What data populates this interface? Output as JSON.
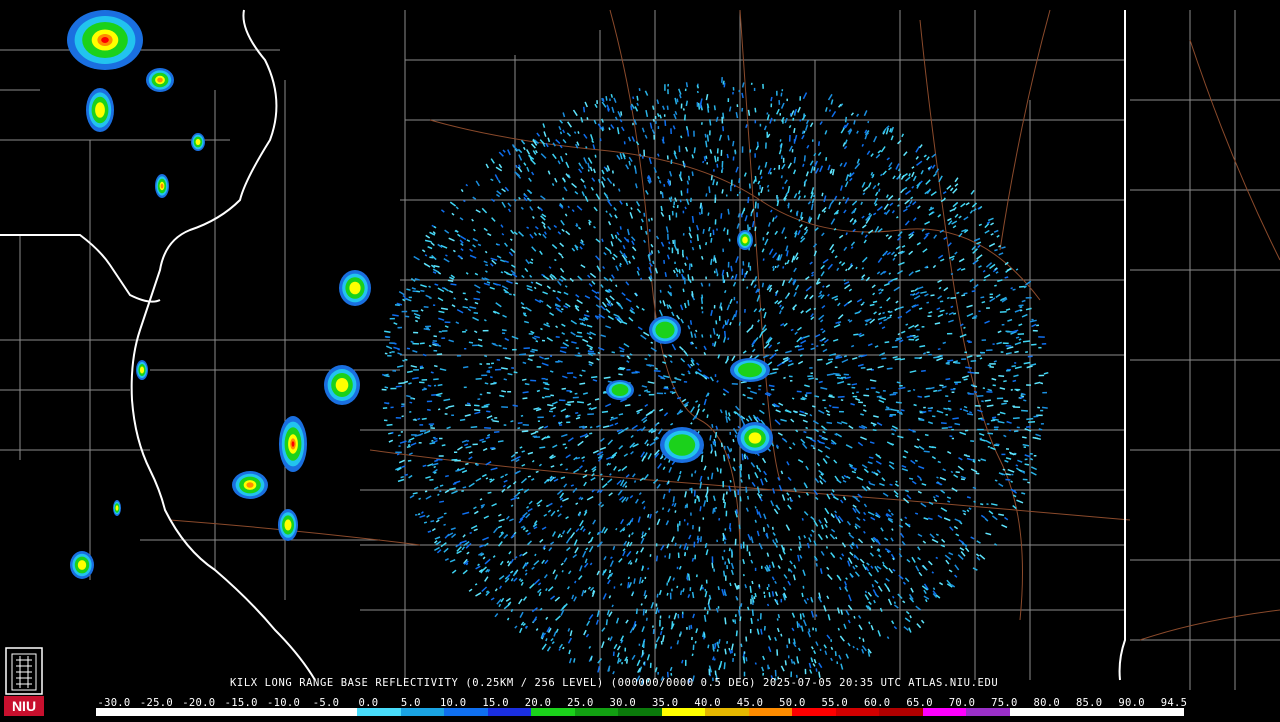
{
  "caption": "KILX LONG RANGE BASE REFLECTIVITY (0.25KM / 256 LEVEL) (000000/0000 0.5 DEG) 2025-07-05 20:35 UTC  ATLAS.NIU.EDU",
  "logo": {
    "text": "NIU",
    "color": "#c8102e"
  },
  "color_scale": {
    "labels": [
      "-30.0",
      "-25.0",
      "-20.0",
      "-15.0",
      "-10.0",
      "-5.0",
      "0.0",
      "5.0",
      "10.0",
      "15.0",
      "20.0",
      "25.0",
      "30.0",
      "35.0",
      "40.0",
      "45.0",
      "50.0",
      "55.0",
      "60.0",
      "65.0",
      "70.0",
      "75.0",
      "80.0",
      "85.0",
      "90.0",
      "94.5"
    ],
    "colors": [
      "#ffffff",
      "#ffffff",
      "#ffffff",
      "#ffffff",
      "#ffffff",
      "#ffffff",
      "#49ddfb",
      "#1aa4e4",
      "#0f6ff0",
      "#1a2fe0",
      "#1bd11b",
      "#12a012",
      "#0b7a0b",
      "#ffff00",
      "#e6b800",
      "#ff8c00",
      "#ff0000",
      "#d20000",
      "#b00000",
      "#ff00ff",
      "#9b30c8",
      "#ffffff",
      "#ffffff",
      "#ffffff",
      "#ffffff"
    ]
  },
  "map": {
    "radar_site": "KILX",
    "state_border_color": "#ffffff",
    "county_line_color": "#9a9a9a",
    "highway_color": "#a0522d",
    "background": "#000000"
  }
}
